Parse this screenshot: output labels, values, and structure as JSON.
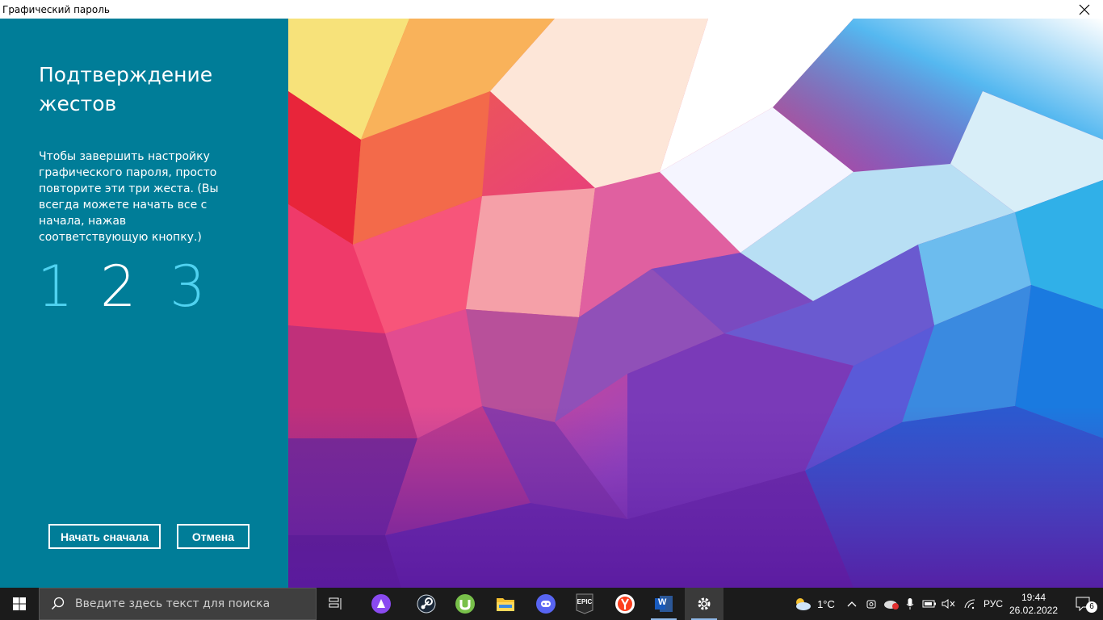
{
  "window": {
    "title": "Графический пароль"
  },
  "panel": {
    "heading": "Подтверждение жестов",
    "description": "Чтобы завершить настройку графического пароля, просто повторите эти три жеста. (Вы всегда можете начать все с начала, нажав соответствующую кнопку.)",
    "steps": [
      "1",
      "2",
      "3"
    ],
    "current_step": 2,
    "restart_label": "Начать сначала",
    "cancel_label": "Отмена",
    "colors": {
      "background": "#007d98",
      "step_inactive": "#4fd2f0",
      "step_active": "#ffffff"
    }
  },
  "taskbar": {
    "search_placeholder": "Введите здесь текст для поиска",
    "pinned": [
      "task-view-icon",
      "alice-icon",
      "steam-icon",
      "utorrent-icon",
      "file-explorer-icon",
      "discord-icon",
      "epic-games-icon",
      "yandex-browser-icon",
      "word-icon",
      "settings-icon"
    ],
    "epic_label": "EPIC",
    "word_label": "W",
    "weather": "1°C",
    "language": "РУС",
    "time": "19:44",
    "date": "26.02.2022",
    "notifications_count": "6"
  }
}
